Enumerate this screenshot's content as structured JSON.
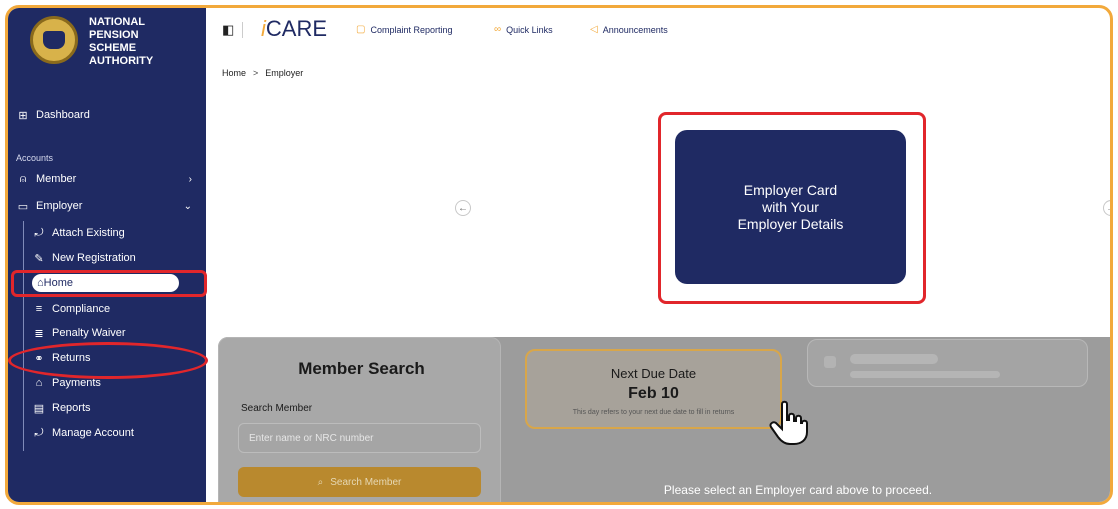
{
  "sidebar": {
    "org_lines": [
      "NATIONAL",
      "PENSION",
      "SCHEME",
      "AUTHORITY"
    ],
    "dashboard": "Dashboard",
    "section_accounts": "Accounts",
    "member": "Member",
    "employer": "Employer",
    "items": [
      {
        "label": "Attach Existing",
        "icon": "attach-icon"
      },
      {
        "label": "New Registration",
        "icon": "edit-icon"
      },
      {
        "label": "Home",
        "icon": "home-icon"
      },
      {
        "label": "Compliance",
        "icon": "list-icon"
      },
      {
        "label": "Penalty Waiver",
        "icon": "waiver-icon"
      },
      {
        "label": "Returns",
        "icon": "returns-icon"
      },
      {
        "label": "Payments",
        "icon": "bank-icon"
      },
      {
        "label": "Reports",
        "icon": "report-icon"
      },
      {
        "label": "Manage Account",
        "icon": "account-icon"
      }
    ]
  },
  "topbar": {
    "brand_prefix": "i",
    "brand_main": "CARE",
    "links": [
      "Complaint Reporting",
      "Quick Links",
      "Announcements"
    ]
  },
  "breadcrumb": {
    "home": "Home",
    "sep": ">",
    "current": "Employer"
  },
  "carousel": {
    "card_lines": [
      "Employer Card",
      "with Your",
      "Employer Details"
    ],
    "prev": "←",
    "next": "→"
  },
  "member_search": {
    "title": "Member Search",
    "label": "Search Member",
    "placeholder": "Enter name or NRC number",
    "button": "Search Member"
  },
  "due_date": {
    "title": "Next Due Date",
    "date": "Feb 10",
    "subtitle": "This day refers to your next due date to fill in returns"
  },
  "proceed_message": "Please select an Employer card above to proceed.",
  "colors": {
    "navy": "#1f2a63",
    "accent": "#f2a93b",
    "highlight": "#e1262b"
  }
}
